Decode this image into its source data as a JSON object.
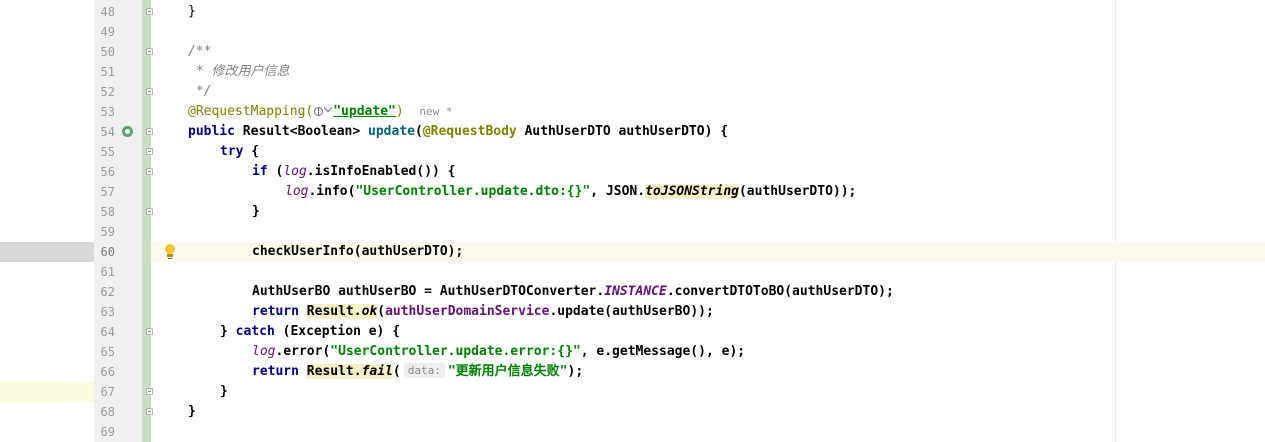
{
  "editor": {
    "lines": [
      {
        "n": "48",
        "fold": true
      },
      {
        "n": "49"
      },
      {
        "n": "50",
        "fold": true
      },
      {
        "n": "51"
      },
      {
        "n": "52",
        "fold": true
      },
      {
        "n": "53"
      },
      {
        "n": "54",
        "fold": true,
        "gutter_icon": "endpoint-icon"
      },
      {
        "n": "55",
        "fold": true
      },
      {
        "n": "56",
        "fold": true
      },
      {
        "n": "57"
      },
      {
        "n": "58",
        "fold": true
      },
      {
        "n": "59"
      },
      {
        "n": "60",
        "current": true,
        "bulb": true
      },
      {
        "n": "61"
      },
      {
        "n": "62"
      },
      {
        "n": "63"
      },
      {
        "n": "64",
        "fold": true
      },
      {
        "n": "65"
      },
      {
        "n": "66"
      },
      {
        "n": "67",
        "fold": true
      },
      {
        "n": "68",
        "fold": true
      },
      {
        "n": "69"
      }
    ],
    "tokens": {
      "l48_brace": "}",
      "l50_open": "/**",
      "l51_comment": " * 修改用户信息",
      "l52_close": " */",
      "l53_ann": "@RequestMapping(",
      "l53_str": "\"update\"",
      "l53_end": ")",
      "l53_hint": "new *",
      "l54_public": "public",
      "l54_type": " Result<Boolean> ",
      "l54_method": "update",
      "l54_paren": "(",
      "l54_ann": "@RequestBody",
      "l54_param": " AuthUserDTO authUserDTO) {",
      "l55_try": "try",
      "l55_brace": " {",
      "l56_if": "if",
      "l56_open": " (",
      "l56_log": "log",
      "l56_rest": ".isInfoEnabled()) {",
      "l57_log": "log",
      "l57_info": ".info(",
      "l57_str": "\"UserController.update.dto:{}\"",
      "l57_json": ", JSON.",
      "l57_method": "toJSONString",
      "l57_rest": "(authUserDTO));",
      "l58_brace": "}",
      "l60_call": "checkUserInfo(authUserDTO);",
      "l62_decl": "AuthUserBO authUserBO = AuthUserDTOConverter.",
      "l62_inst": "INSTANCE",
      "l62_rest": ".convertDTOToBO(authUserDTO);",
      "l63_return": "return",
      "l63_result": "Result.",
      "l63_ok": "ok",
      "l63_paren": "(",
      "l63_field": "authUserDomainService",
      "l63_rest": ".update(authUserBO));",
      "l64_close": "} ",
      "l64_catch": "catch",
      "l64_rest": " (Exception e) {",
      "l65_log": "log",
      "l65_err": ".error(",
      "l65_str": "\"UserController.update.error:{}\"",
      "l65_rest": ", e.getMessage(), e);",
      "l66_return": "return",
      "l66_result": "Result.",
      "l66_fail": "fail",
      "l66_paren": "(",
      "l66_hint": "data:",
      "l66_str": "\"更新用户信息失败\"",
      "l66_end": ");",
      "l67_brace": "}",
      "l68_brace": "}"
    }
  },
  "colors": {
    "gutter_bg": "#f0f0f0",
    "change_bar": "#c9dfc2",
    "current_line": "#fcfaed",
    "keyword": "#000080",
    "string": "#008000",
    "annotation": "#808000",
    "field": "#660e7a",
    "comment": "#808080"
  }
}
